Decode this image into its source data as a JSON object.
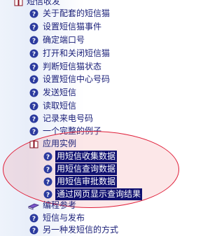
{
  "tree": {
    "book_sms": "短信收发",
    "topics": [
      "关于配套的短信猫",
      "设置短信猫事件",
      "确定端口号",
      "打开和关闭短信猫",
      "判断短信猫状态",
      "设置短信中心号码",
      "发送短信",
      "读取短信",
      "记录来电号码",
      "一个完整的例子"
    ],
    "book_apps": "应用实例",
    "app_topics": [
      "用短信收集数据",
      "用短信查询数据",
      "用短信审批数据",
      "通过网页显示查询结果"
    ],
    "book_reference": "编程参考",
    "tail_topics": [
      "短信与发布",
      "另一种发短信的方式"
    ]
  },
  "colors": {
    "text": "#1a1f78",
    "selection": "#0f1070",
    "highlight_ellipse": "#e0203a",
    "topic_icon": "#2b3a9e"
  },
  "icons": {
    "topic": "help-topic-icon",
    "open_book": "open-book-icon",
    "closed_book": "closed-book-icon"
  }
}
